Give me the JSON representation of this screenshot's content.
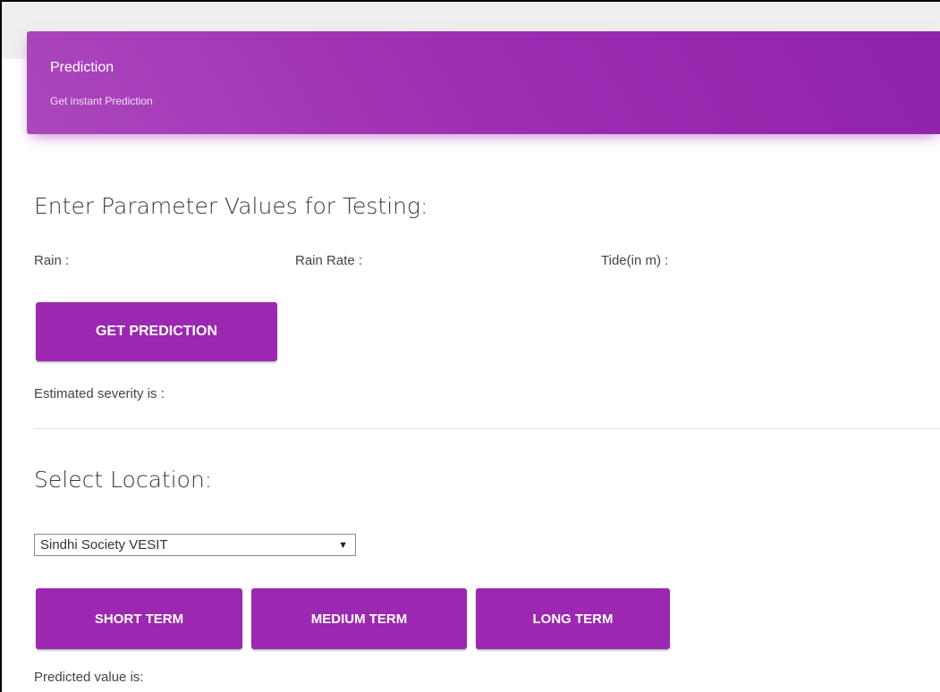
{
  "header": {
    "title": "Prediction",
    "subtitle": "Get instant Prediction"
  },
  "testing": {
    "heading": "Enter Parameter Values for Testing:",
    "rain_label": "Rain :",
    "rain_rate_label": "Rain Rate :",
    "tide_label": "Tide(in m) :",
    "predict_button": "GET PREDICTION",
    "severity_text": "Estimated severity is :"
  },
  "location": {
    "heading": "Select Location:",
    "selected": "Sindhi Society VESIT",
    "dropdown_icon": "triangle-down-icon",
    "buttons": {
      "short_term": "SHORT TERM",
      "medium_term": "MEDIUM TERM",
      "long_term": "LONG TERM"
    },
    "predicted_text": "Predicted value is:"
  },
  "colors": {
    "accent": "#9c27b0",
    "header_gradient_start": "#ab47bc",
    "header_gradient_end": "#8e24aa"
  }
}
